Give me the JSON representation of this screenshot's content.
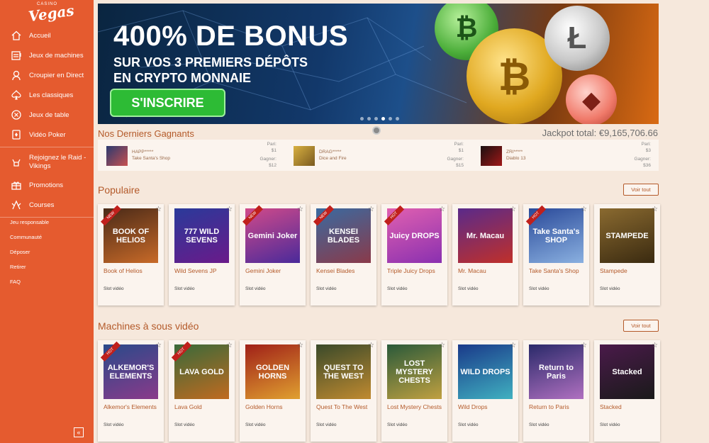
{
  "brand": {
    "top": "CASINO",
    "name": "Vegas"
  },
  "nav": [
    {
      "label": "Accueil",
      "icon": "home-icon"
    },
    {
      "label": "Jeux de machines",
      "icon": "slot-machine-icon"
    },
    {
      "label": "Croupier en Direct",
      "icon": "dealer-icon"
    },
    {
      "label": "Les classiques",
      "icon": "cards-icon"
    },
    {
      "label": "Jeux de table",
      "icon": "chip-icon"
    },
    {
      "label": "Vidéo Poker",
      "icon": "poker-card-icon"
    }
  ],
  "nav2": [
    {
      "label": "Rejoignez le Raid - Vikings",
      "icon": "viking-icon"
    },
    {
      "label": "Promotions",
      "icon": "gift-icon"
    },
    {
      "label": "Courses",
      "icon": "race-flags-icon"
    }
  ],
  "links": [
    "Jeu responsable",
    "Communauté",
    "Déposer",
    "Retirer",
    "FAQ"
  ],
  "collapse": "«",
  "banner": {
    "title": "400% DE BONUS",
    "sub1": "SUR VOS 3 PREMIERS DÉPÔTS",
    "sub2": "EN CRYPTO MONNAIE",
    "cta": "S'INSCRIRE",
    "coin_btc": "₿",
    "coin_ltc": "Ł",
    "coin_eth": "◆",
    "coin_green": "₿",
    "active_slide": 4
  },
  "winners": {
    "title": "Nos Derniers Gagnants",
    "jackpot": "Jackpot total: €9,165,706.66",
    "items": [
      {
        "name": "HAPP*****",
        "game": "Take Santa's Shop",
        "pari_label": "Pari:",
        "pari": "$1",
        "gain_label": "Gagner:",
        "gain": "$12"
      },
      {
        "name": "DRAG*****",
        "game": "Dice and Fire",
        "pari_label": "Pari:",
        "pari": "$1",
        "gain_label": "Gagner:",
        "gain": "$15"
      },
      {
        "name": "ZRI*****",
        "game": "Diablo 13",
        "pari_label": "Pari:",
        "pari": "$3",
        "gain_label": "Gagner:",
        "gain": "$36"
      }
    ]
  },
  "sections": [
    {
      "title": "Populaire",
      "voir": "Voir tout",
      "games": [
        {
          "name": "Book of Helios",
          "type": "Slot vidéo",
          "art": "BOOK OF HELIOS",
          "hot": "NEW"
        },
        {
          "name": "Wild Sevens JP",
          "type": "Slot vidéo",
          "art": "777 WILD SEVENS",
          "hot": ""
        },
        {
          "name": "Gemini Joker",
          "type": "Slot vidéo",
          "art": "Gemini Joker",
          "hot": "NEW"
        },
        {
          "name": "Kensei Blades",
          "type": "Slot vidéo",
          "art": "KENSEI BLADES",
          "hot": "NEW"
        },
        {
          "name": "Triple Juicy Drops",
          "type": "Slot vidéo",
          "art": "Juicy DROPS",
          "hot": "HOT"
        },
        {
          "name": "Mr. Macau",
          "type": "Slot vidéo",
          "art": "Mr. Macau",
          "hot": ""
        },
        {
          "name": "Take Santa's Shop",
          "type": "Slot vidéo",
          "art": "Take Santa's SHOP",
          "hot": "HOT"
        },
        {
          "name": "Stampede",
          "type": "Slot vidéo",
          "art": "STAMPEDE",
          "hot": ""
        }
      ]
    },
    {
      "title": "Machines à sous vidéo",
      "voir": "Voir tout",
      "games": [
        {
          "name": "Alkemor's Elements",
          "type": "Slot vidéo",
          "art": "ALKEMOR'S ELEMENTS",
          "hot": "HOT"
        },
        {
          "name": "Lava Gold",
          "type": "Slot vidéo",
          "art": "LAVA GOLD",
          "hot": "HOT"
        },
        {
          "name": "Golden Horns",
          "type": "Slot vidéo",
          "art": "GOLDEN HORNS",
          "hot": ""
        },
        {
          "name": "Quest To The West",
          "type": "Slot vidéo",
          "art": "QUEST TO THE WEST",
          "hot": ""
        },
        {
          "name": "Lost Mystery Chests",
          "type": "Slot vidéo",
          "art": "LOST MYSTERY CHESTS",
          "hot": ""
        },
        {
          "name": "Wild Drops",
          "type": "Slot vidéo",
          "art": "WILD DROPS",
          "hot": ""
        },
        {
          "name": "Return to Paris",
          "type": "Slot vidéo",
          "art": "Return to Paris",
          "hot": ""
        },
        {
          "name": "Stacked",
          "type": "Slot vidéo",
          "art": "Stacked",
          "hot": ""
        }
      ]
    }
  ]
}
